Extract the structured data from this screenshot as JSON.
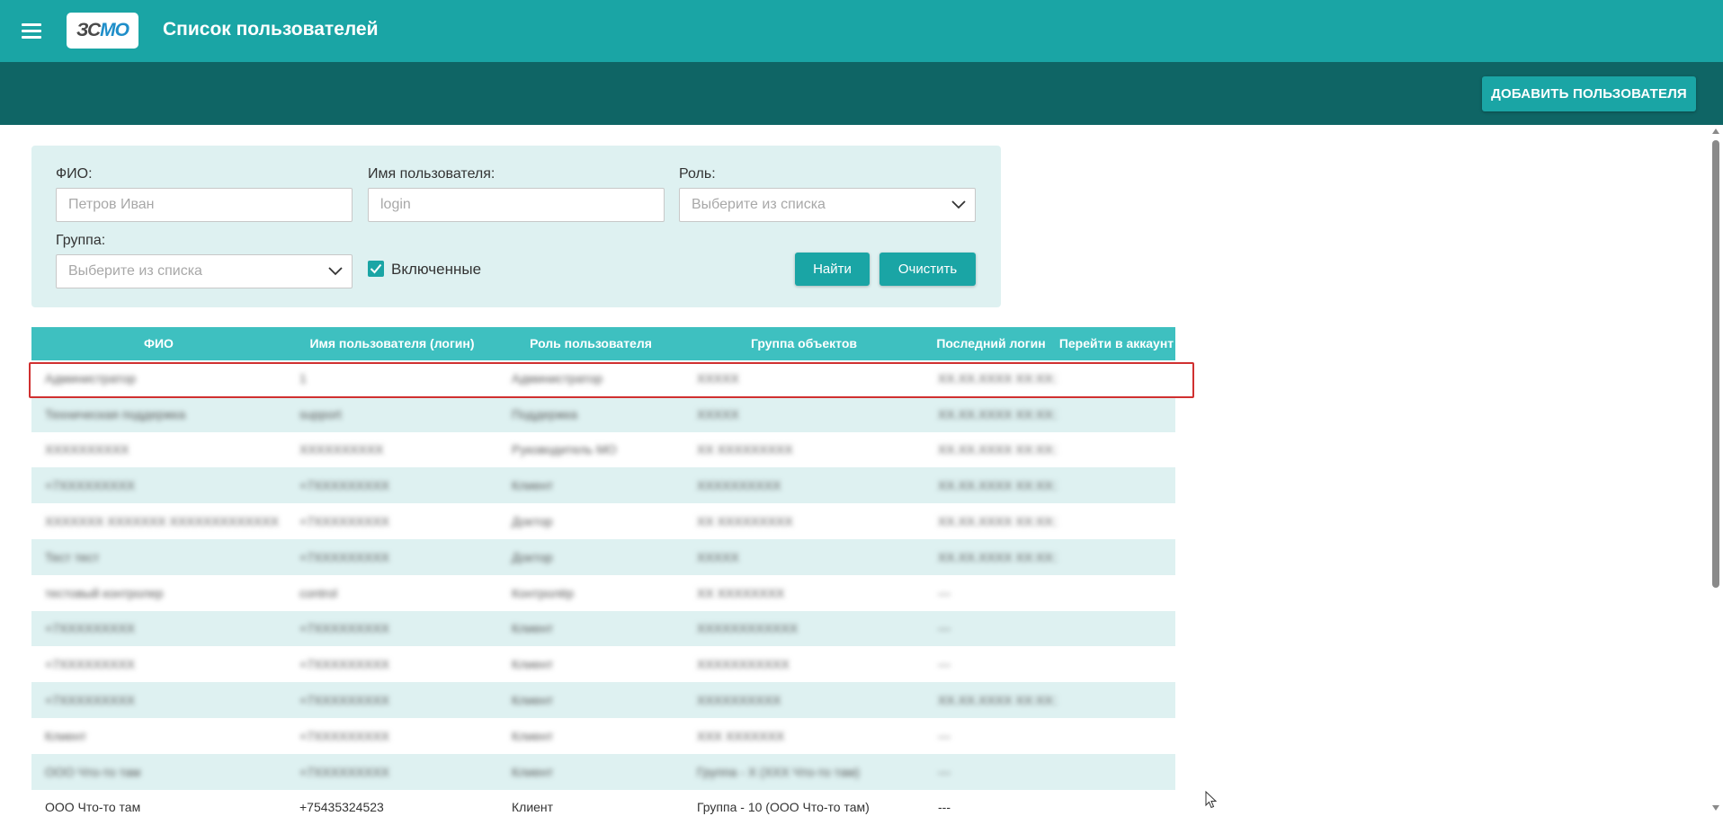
{
  "header": {
    "logo_text": "ЗСМО",
    "title": "Список пользователей"
  },
  "toolbar": {
    "add_user_label": "ДОБАВИТЬ ПОЛЬЗОВАТЕЛЯ"
  },
  "filters": {
    "fio_label": "ФИО:",
    "fio_placeholder": "Петров Иван",
    "username_label": "Имя пользователя:",
    "username_placeholder": "login",
    "role_label": "Роль:",
    "role_placeholder": "Выберите из списка",
    "group_label": "Группа:",
    "group_placeholder": "Выберите из списка",
    "enabled_label": "Включенные",
    "enabled_checked": true,
    "find_label": "Найти",
    "clear_label": "Очистить"
  },
  "table": {
    "columns": [
      "ФИО",
      "Имя пользователя (логин)",
      "Роль пользователя",
      "Группа объектов",
      "Последний логин",
      "Перейти в аккаунт"
    ],
    "rows": [
      {
        "fio": "Администратор",
        "login": "1",
        "role": "Администратор",
        "group": "XXXXX",
        "last": "XX.XX.XXXX XX:XX:XX",
        "blur": true
      },
      {
        "fio": "Техническая поддержка",
        "login": "support",
        "role": "Поддержка",
        "group": "XXXXX",
        "last": "XX.XX.XXXX XX:XX:XX",
        "blur": true
      },
      {
        "fio": "XXXXXXXXXX",
        "login": "XXXXXXXXXX",
        "role": "Руководитель МО",
        "group": "XX XXXXXXXXX",
        "last": "XX.XX.XXXX XX:XX:XX",
        "blur": true
      },
      {
        "fio": "+7XXXXXXXXX",
        "login": "+7XXXXXXXXX",
        "role": "Клиент",
        "group": "XXXXXXXXXX",
        "last": "XX.XX.XXXX XX:XX:XX",
        "blur": true
      },
      {
        "fio": "XXXXXXX XXXXXXX XXXXXXXXXXXXX",
        "login": "+7XXXXXXXXX",
        "role": "Доктор",
        "group": "XX XXXXXXXXX",
        "last": "XX.XX.XXXX XX:XX:XX",
        "blur": true
      },
      {
        "fio": "Тест тест",
        "login": "+7XXXXXXXXX",
        "role": "Доктор",
        "group": "XXXXX",
        "last": "XX.XX.XXXX XX:XX:XX",
        "blur": true
      },
      {
        "fio": "тестовый контролер",
        "login": "control",
        "role": "Контролёр",
        "group": "XX XXXXXXXX",
        "last": "---",
        "blur": true
      },
      {
        "fio": "+7XXXXXXXXX",
        "login": "+7XXXXXXXXX",
        "role": "Клиент",
        "group": "XXXXXXXXXXXX",
        "last": "---",
        "blur": true
      },
      {
        "fio": "+7XXXXXXXXX",
        "login": "+7XXXXXXXXX",
        "role": "Клиент",
        "group": "XXXXXXXXXXX",
        "last": "---",
        "blur": true
      },
      {
        "fio": "+7XXXXXXXXX",
        "login": "+7XXXXXXXXX",
        "role": "Клиент",
        "group": "XXXXXXXXXX",
        "last": "XX.XX.XXXX XX:XX:XX",
        "blur": true
      },
      {
        "fio": "Клиент",
        "login": "+7XXXXXXXXX",
        "role": "Клиент",
        "group": "XXX XXXXXXX",
        "last": "---",
        "blur": true
      },
      {
        "fio": "ООО Что-то там",
        "login": "+7XXXXXXXXX",
        "role": "Клиент",
        "group": "Группа - X (XXX Что-то там)",
        "last": "---",
        "blur": true
      },
      {
        "fio": "ООО Что-то там",
        "login": "+75435324523",
        "role": "Клиент",
        "group": "Группа - 10 (ООО Что-то там)",
        "last": "---",
        "blur": false
      }
    ]
  },
  "colors": {
    "primary": "#1aa5a5",
    "dark": "#0f6565",
    "table_header": "#3ec0c0",
    "row_alt": "#def1f1",
    "filter_bg": "#def1f1",
    "highlight": "#d03030"
  }
}
